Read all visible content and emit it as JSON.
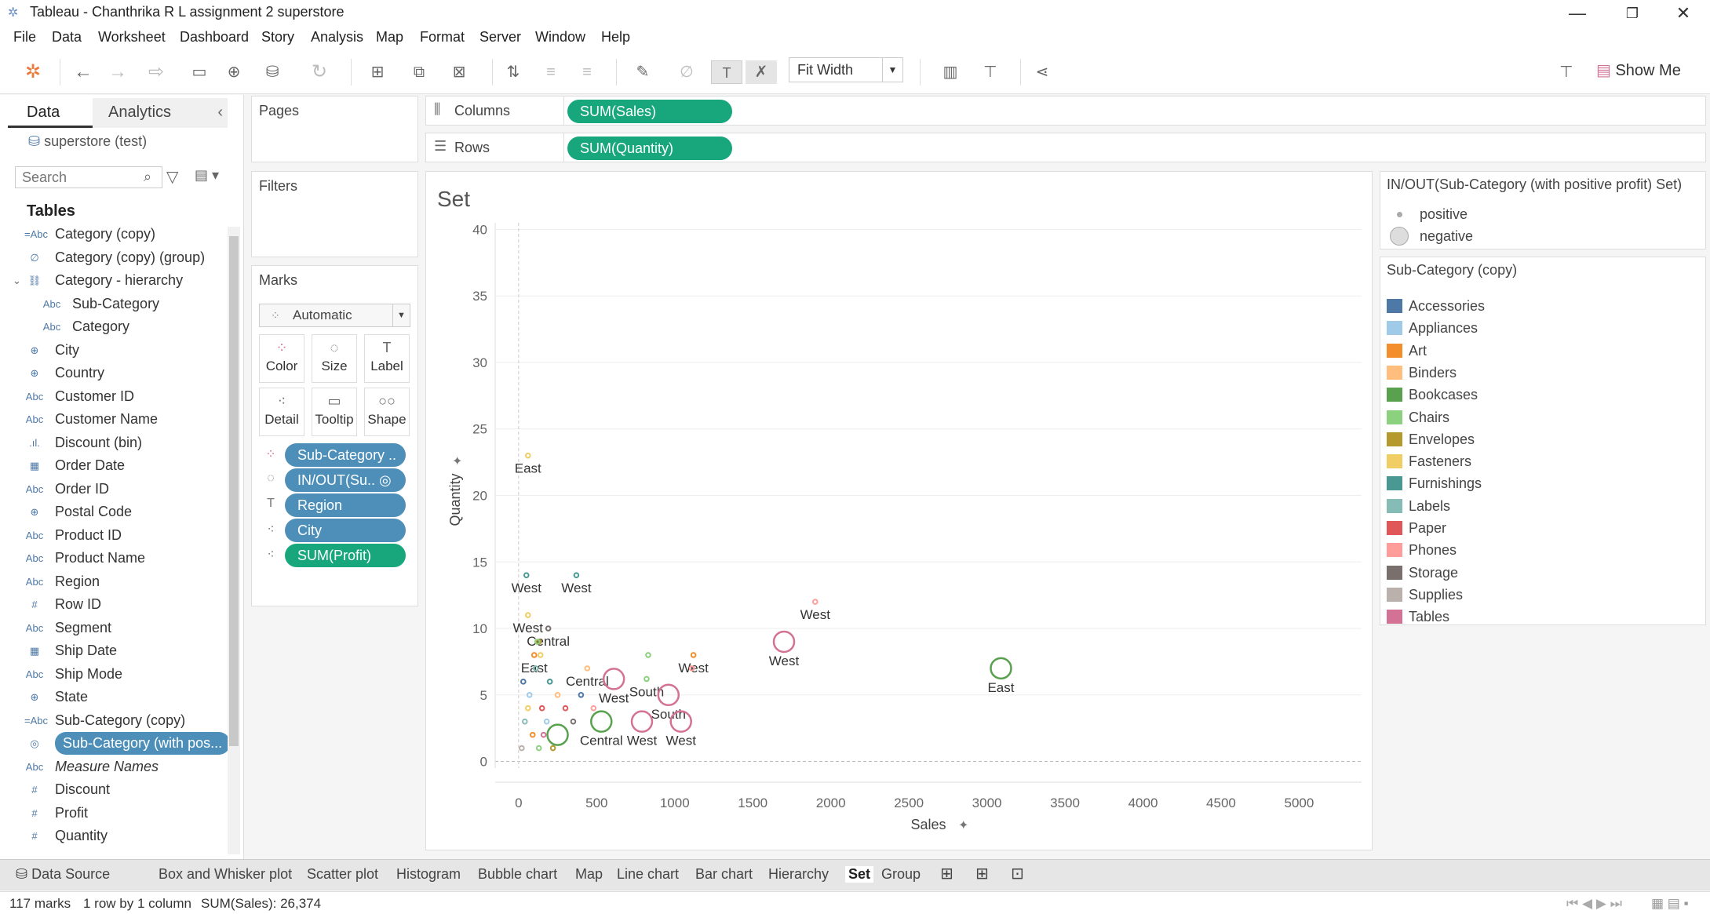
{
  "window": {
    "title": "Tableau - Chanthrika R L assignment 2 superstore",
    "minimize": "—",
    "restore": "❐",
    "close": "✕"
  },
  "menu": [
    "File",
    "Data",
    "Worksheet",
    "Dashboard",
    "Story",
    "Analysis",
    "Map",
    "Format",
    "Server",
    "Window",
    "Help"
  ],
  "toolbar": {
    "fit": "Fit Width",
    "show_me": "Show Me"
  },
  "data_pane": {
    "tab_data": "Data",
    "tab_analytics": "Analytics",
    "datasource": "superstore (test)",
    "search_placeholder": "Search",
    "tables_header": "Tables",
    "fields": [
      {
        "icon": "=Abc",
        "label": "Category (copy)"
      },
      {
        "icon": "∅",
        "label": "Category (copy) (group)"
      },
      {
        "icon": "⛓",
        "label": "Category - hierarchy"
      },
      {
        "icon": "Abc",
        "label": "Sub-Category"
      },
      {
        "icon": "Abc",
        "label": "Category"
      },
      {
        "icon": "⊕",
        "label": "City"
      },
      {
        "icon": "⊕",
        "label": "Country"
      },
      {
        "icon": "Abc",
        "label": "Customer ID"
      },
      {
        "icon": "Abc",
        "label": "Customer Name"
      },
      {
        "icon": ".ıl.",
        "label": "Discount (bin)"
      },
      {
        "icon": "▦",
        "label": "Order Date"
      },
      {
        "icon": "Abc",
        "label": "Order ID"
      },
      {
        "icon": "⊕",
        "label": "Postal Code"
      },
      {
        "icon": "Abc",
        "label": "Product ID"
      },
      {
        "icon": "Abc",
        "label": "Product Name"
      },
      {
        "icon": "Abc",
        "label": "Region"
      },
      {
        "icon": "#",
        "label": "Row ID"
      },
      {
        "icon": "Abc",
        "label": "Segment"
      },
      {
        "icon": "▦",
        "label": "Ship Date"
      },
      {
        "icon": "Abc",
        "label": "Ship Mode"
      },
      {
        "icon": "⊕",
        "label": "State"
      },
      {
        "icon": "=Abc",
        "label": "Sub-Category (copy)"
      },
      {
        "icon": "◎",
        "label": "Sub-Category (with pos..."
      },
      {
        "icon": "Abc",
        "label": "Measure Names"
      },
      {
        "icon": "#",
        "label": "Discount"
      },
      {
        "icon": "#",
        "label": "Profit"
      },
      {
        "icon": "#",
        "label": "Quantity"
      }
    ]
  },
  "shelves": {
    "pages": "Pages",
    "filters": "Filters",
    "marks": "Marks",
    "mark_type": "Automatic",
    "columns_label": "Columns",
    "rows_label": "Rows",
    "columns_pill": "SUM(Sales)",
    "rows_pill": "SUM(Quantity)",
    "mark_buttons": [
      "Color",
      "Size",
      "Label",
      "Detail",
      "Tooltip",
      "Shape"
    ],
    "mark_pills": [
      "Sub-Category ..",
      "IN/OUT(Su.. ◎",
      "Region",
      "City",
      "SUM(Profit)"
    ]
  },
  "legends": {
    "set_title": "IN/OUT(Sub-Category (with positive profit) Set)",
    "set_items": [
      "positive",
      "negative"
    ],
    "color_title": "Sub-Category (copy)",
    "color_items": [
      {
        "label": "Accessories",
        "color": "#4e79a7"
      },
      {
        "label": "Appliances",
        "color": "#a0cbe8"
      },
      {
        "label": "Art",
        "color": "#f28e2b"
      },
      {
        "label": "Binders",
        "color": "#ffbe7d"
      },
      {
        "label": "Bookcases",
        "color": "#59a14f"
      },
      {
        "label": "Chairs",
        "color": "#8cd17d"
      },
      {
        "label": "Envelopes",
        "color": "#b6992d"
      },
      {
        "label": "Fasteners",
        "color": "#f1ce63"
      },
      {
        "label": "Furnishings",
        "color": "#499894"
      },
      {
        "label": "Labels",
        "color": "#86bcb6"
      },
      {
        "label": "Paper",
        "color": "#e15759"
      },
      {
        "label": "Phones",
        "color": "#ff9d9a"
      },
      {
        "label": "Storage",
        "color": "#79706e"
      },
      {
        "label": "Supplies",
        "color": "#bab0ac"
      },
      {
        "label": "Tables",
        "color": "#d37295"
      }
    ]
  },
  "chart_data": {
    "type": "scatter",
    "title": "Set",
    "xlabel": "Sales",
    "ylabel": "Quantity",
    "xlim": [
      -150,
      5400
    ],
    "ylim": [
      -0.5,
      40.5
    ],
    "xticks": [
      0,
      500,
      1000,
      1500,
      2000,
      2500,
      3000,
      3500,
      4000,
      4500,
      5000
    ],
    "yticks": [
      0,
      5,
      10,
      15,
      20,
      25,
      30,
      35,
      40
    ],
    "points": [
      {
        "x": 60,
        "y": 23,
        "color": "#f1ce63",
        "size": "small",
        "label": "East"
      },
      {
        "x": 50,
        "y": 14,
        "color": "#499894",
        "size": "small",
        "label": "West"
      },
      {
        "x": 370,
        "y": 14,
        "color": "#499894",
        "size": "small",
        "label": "West"
      },
      {
        "x": 60,
        "y": 11,
        "color": "#f1ce63",
        "size": "small",
        "label": "West"
      },
      {
        "x": 190,
        "y": 10,
        "color": "#79706e",
        "size": "small",
        "label": "Central"
      },
      {
        "x": 1900,
        "y": 12,
        "color": "#ff9d9a",
        "size": "small",
        "label": "West"
      },
      {
        "x": 130,
        "y": 9,
        "color": "#b6992d",
        "size": "small",
        "label": ""
      },
      {
        "x": 120,
        "y": 9,
        "color": "#8cd17d",
        "size": "small",
        "label": ""
      },
      {
        "x": 100,
        "y": 8,
        "color": "#f28e2b",
        "size": "small",
        "label": "East"
      },
      {
        "x": 140,
        "y": 8,
        "color": "#f1ce63",
        "size": "small",
        "label": ""
      },
      {
        "x": 1120,
        "y": 8,
        "color": "#f28e2b",
        "size": "small",
        "label": "West"
      },
      {
        "x": 830,
        "y": 8,
        "color": "#8cd17d",
        "size": "small",
        "label": ""
      },
      {
        "x": 1110,
        "y": 7,
        "color": "#ff9d9a",
        "size": "small",
        "label": ""
      },
      {
        "x": 440,
        "y": 7,
        "color": "#ffbe7d",
        "size": "small",
        "label": "Central"
      },
      {
        "x": 610,
        "y": 6.2,
        "color": "#d37295",
        "size": "large",
        "label": "West"
      },
      {
        "x": 820,
        "y": 6.2,
        "color": "#8cd17d",
        "size": "small",
        "label": "South"
      },
      {
        "x": 960,
        "y": 5,
        "color": "#d37295",
        "size": "large",
        "label": "South"
      },
      {
        "x": 1700,
        "y": 9,
        "color": "#d37295",
        "size": "large",
        "label": "West"
      },
      {
        "x": 3090,
        "y": 7,
        "color": "#59a14f",
        "size": "large",
        "label": "East"
      },
      {
        "x": 530,
        "y": 3,
        "color": "#59a14f",
        "size": "large",
        "label": "Central"
      },
      {
        "x": 790,
        "y": 3,
        "color": "#d37295",
        "size": "large",
        "label": "West"
      },
      {
        "x": 1040,
        "y": 3,
        "color": "#d37295",
        "size": "large",
        "label": "West"
      },
      {
        "x": 250,
        "y": 2,
        "color": "#59a14f",
        "size": "large",
        "label": ""
      },
      {
        "x": 30,
        "y": 6,
        "color": "#4e79a7",
        "size": "small",
        "label": ""
      },
      {
        "x": 70,
        "y": 5,
        "color": "#a0cbe8",
        "size": "small",
        "label": ""
      },
      {
        "x": 150,
        "y": 4,
        "color": "#e15759",
        "size": "small",
        "label": ""
      },
      {
        "x": 40,
        "y": 3,
        "color": "#86bcb6",
        "size": "small",
        "label": ""
      },
      {
        "x": 90,
        "y": 2,
        "color": "#f28e2b",
        "size": "small",
        "label": ""
      },
      {
        "x": 20,
        "y": 1,
        "color": "#bab0ac",
        "size": "small",
        "label": ""
      },
      {
        "x": 200,
        "y": 6,
        "color": "#499894",
        "size": "small",
        "label": ""
      },
      {
        "x": 250,
        "y": 5,
        "color": "#ffbe7d",
        "size": "small",
        "label": ""
      },
      {
        "x": 300,
        "y": 4,
        "color": "#e15759",
        "size": "small",
        "label": ""
      },
      {
        "x": 350,
        "y": 3,
        "color": "#79706e",
        "size": "small",
        "label": ""
      },
      {
        "x": 400,
        "y": 5,
        "color": "#4e79a7",
        "size": "small",
        "label": ""
      },
      {
        "x": 110,
        "y": 7,
        "color": "#86bcb6",
        "size": "small",
        "label": ""
      },
      {
        "x": 180,
        "y": 3,
        "color": "#a0cbe8",
        "size": "small",
        "label": ""
      },
      {
        "x": 60,
        "y": 4,
        "color": "#f1ce63",
        "size": "small",
        "label": ""
      },
      {
        "x": 220,
        "y": 1,
        "color": "#b6992d",
        "size": "small",
        "label": ""
      },
      {
        "x": 160,
        "y": 2,
        "color": "#d37295",
        "size": "small",
        "label": ""
      },
      {
        "x": 480,
        "y": 4,
        "color": "#ff9d9a",
        "size": "small",
        "label": ""
      },
      {
        "x": 130,
        "y": 1,
        "color": "#8cd17d",
        "size": "small",
        "label": ""
      }
    ]
  },
  "sheet_tabs": [
    "Data Source",
    "Box and Whisker plot",
    "Scatter plot",
    "Histogram",
    "Bubble chart",
    "Map",
    "Line chart",
    "Bar chart",
    "Hierarchy",
    "Set",
    "Group"
  ],
  "active_tab": "Set",
  "status": {
    "marks": "117 marks",
    "rows": "1 row by 1 column",
    "sum": "SUM(Sales): 26,374"
  }
}
